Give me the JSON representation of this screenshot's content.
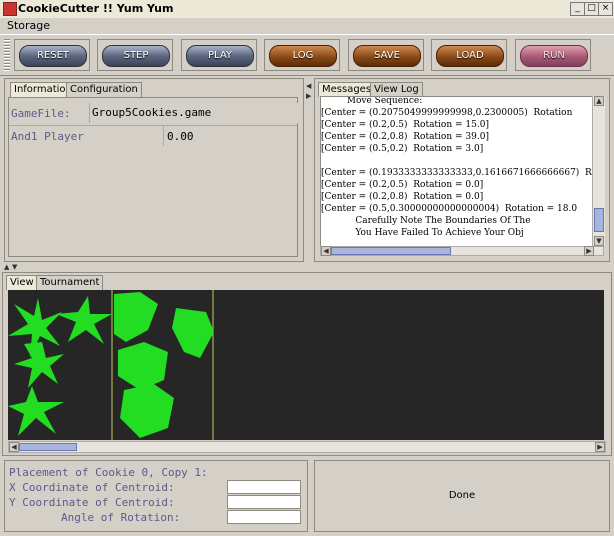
{
  "window": {
    "title": "CookieCutter !! Yum Yum",
    "min_glyph": "_",
    "max_glyph": "□",
    "close_glyph": "×"
  },
  "menu": {
    "storage": "Storage"
  },
  "toolbar": {
    "reset": "RESET",
    "step": "STEP",
    "play": "PLAY",
    "log": "LOG",
    "save": "SAVE",
    "load": "LOAD",
    "run": "RUN"
  },
  "info_panel": {
    "tabs": [
      "Information",
      "Configuration"
    ],
    "gamefile_label": "GameFile:",
    "gamefile_value": "Group5Cookies.game",
    "player_label": "And1 Player",
    "player_value": "0.00"
  },
  "messages_panel": {
    "tabs": [
      "Messages",
      "View Log"
    ],
    "lines": [
      "         Move Sequence:",
      "[Center = (0.2075049999999998,0.2300005)  Rotation",
      "[Center = (0.2,0.5)  Rotation = 15.0]",
      "[Center = (0.2,0.8)  Rotation = 39.0]",
      "[Center = (0.5,0.2)  Rotation = 3.0]",
      "",
      "[Center = (0.1933333333333333,0.1616671666666667)  R",
      "[Center = (0.2,0.5)  Rotation = 0.0]",
      "[Center = (0.2,0.8)  Rotation = 0.0]",
      "[Center = (0.5,0.30000000000000004)  Rotation = 18.0",
      "            Carefully Note The Boundaries Of The",
      "            You Have Failed To Achieve Your Obj"
    ]
  },
  "view_panel": {
    "tabs": [
      "View",
      "Tournament"
    ]
  },
  "placement": {
    "title": "Placement of Cookie 0, Copy 1:",
    "x_label": "X Coordinate of Centroid:",
    "y_label": "Y Coordinate of Centroid:",
    "angle_label": "Angle of Rotation:",
    "x_value": "",
    "y_value": "",
    "angle_value": ""
  },
  "done_label": "Done",
  "colors": {
    "cookie_green": "#22dd22",
    "canvas_bg": "#262626",
    "boundary": "#c8c860"
  }
}
